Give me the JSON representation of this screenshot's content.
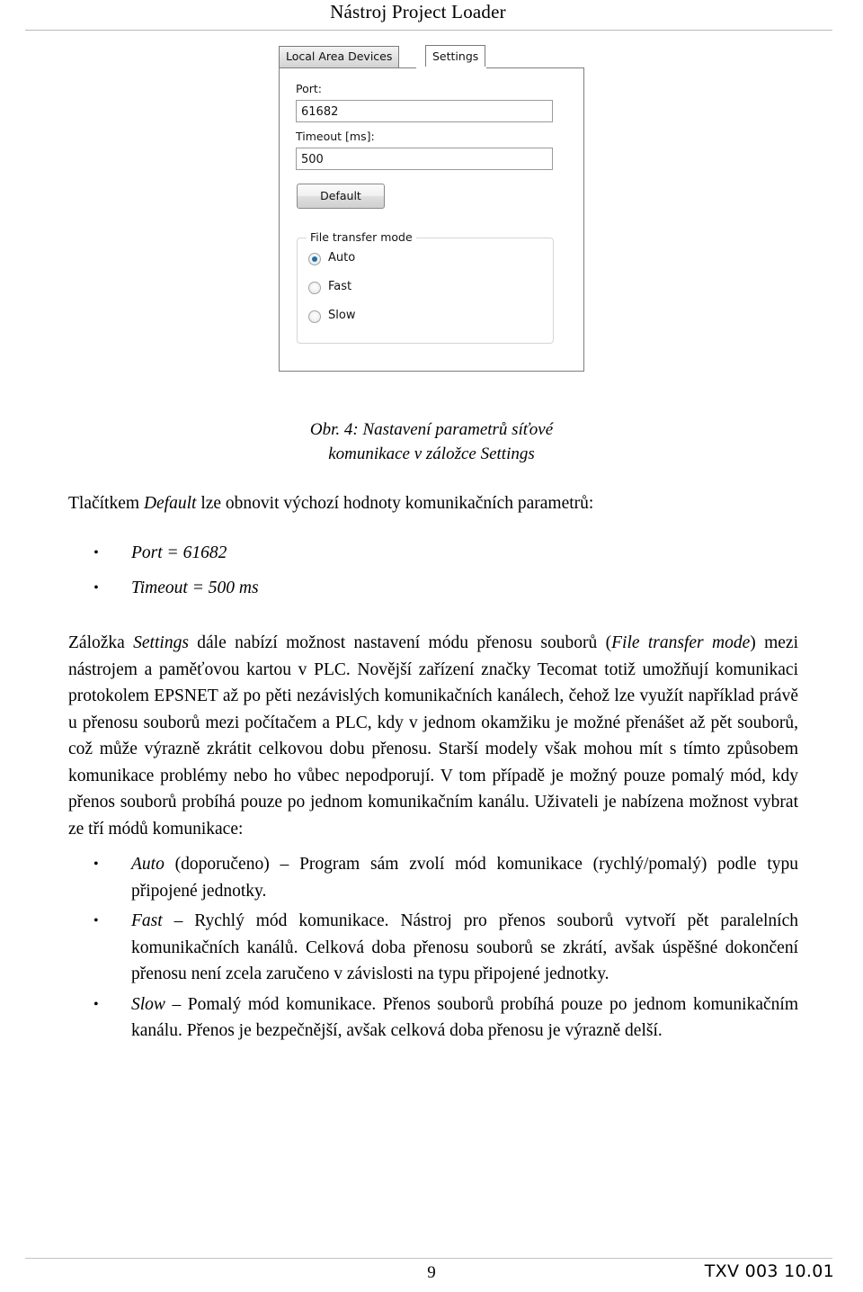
{
  "header": {
    "title": "Nástroj Project Loader"
  },
  "figure": {
    "tabs": [
      {
        "label": "Local Area Devices",
        "active": false
      },
      {
        "label": "Settings",
        "active": true
      }
    ],
    "port": {
      "label": "Port:",
      "value": "61682"
    },
    "timeout": {
      "label": "Timeout [ms]:",
      "value": "500"
    },
    "default_button": "Default",
    "file_transfer_mode": {
      "title": "File transfer mode",
      "options": [
        {
          "label": "Auto",
          "selected": true
        },
        {
          "label": "Fast",
          "selected": false
        },
        {
          "label": "Slow",
          "selected": false
        }
      ]
    }
  },
  "caption": {
    "line1": "Obr. 4: Nastavení parametrů síťové",
    "line2": "komunikace v záložce Settings"
  },
  "body": {
    "lead": "Tlačítkem Default lze obnovit výchozí hodnoty komunikačních parametrů:",
    "lead_italic_word": "Default",
    "lead_prefix": "Tlačítkem ",
    "lead_suffix": " lze obnovit výchozí hodnoty komunikačních parametrů:",
    "bullets_top": [
      "Port = 61682",
      "Timeout = 500 ms"
    ],
    "paragraph_part1": "Záložka ",
    "paragraph_italic1": "Settings",
    "paragraph_part2": " dále nabízí možnost nastavení módu přenosu souborů (",
    "paragraph_italic2": "File transfer mode",
    "paragraph_part3": ") mezi nástrojem a paměťovou kartou v PLC. Novější zařízení značky Tecomat totiž umožňují komunikaci protokolem EPSNET až po pěti nezávislých komunikačních kanálech, čehož lze využít například právě u přenosu souborů mezi počítačem a PLC, kdy v jednom okamžiku je možné přenášet až pět souborů, což může výrazně zkrátit celkovou dobu přenosu. Starší modely však mohou mít s tímto způsobem komunikace problémy nebo ho vůbec nepodporují. V tom případě je možný pouze pomalý mód, kdy přenos souborů probíhá pouze po jednom komunikačním kanálu. Uživateli je nabízena možnost vybrat ze tří módů komunikace:",
    "bullets_bottom": [
      {
        "term": "Auto",
        "rest": " (doporučeno) – Program sám zvolí mód komunikace (rychlý/pomalý) podle typu připojené jednotky."
      },
      {
        "term": "Fast",
        "rest": " – Rychlý mód komunikace. Nástroj pro přenos souborů vytvoří pět paralelních komunikačních kanálů. Celková doba přenosu souborů se zkrátí, avšak úspěšné dokončení přenosu není zcela zaručeno v závislosti na typu připojené jednotky."
      },
      {
        "term": "Slow",
        "rest": " – Pomalý mód komunikace. Přenos souborů probíhá pouze po jednom komunikačním kanálu. Přenos je bezpečnější, avšak celková doba přenosu je výrazně delší."
      }
    ],
    "bullet_glyph": "•"
  },
  "footer": {
    "page_number": "9",
    "document_code": "TXV 003 10.01"
  },
  "colors": {
    "accent_radio": "#1f6fa8",
    "rule": "#b9b9b9"
  }
}
